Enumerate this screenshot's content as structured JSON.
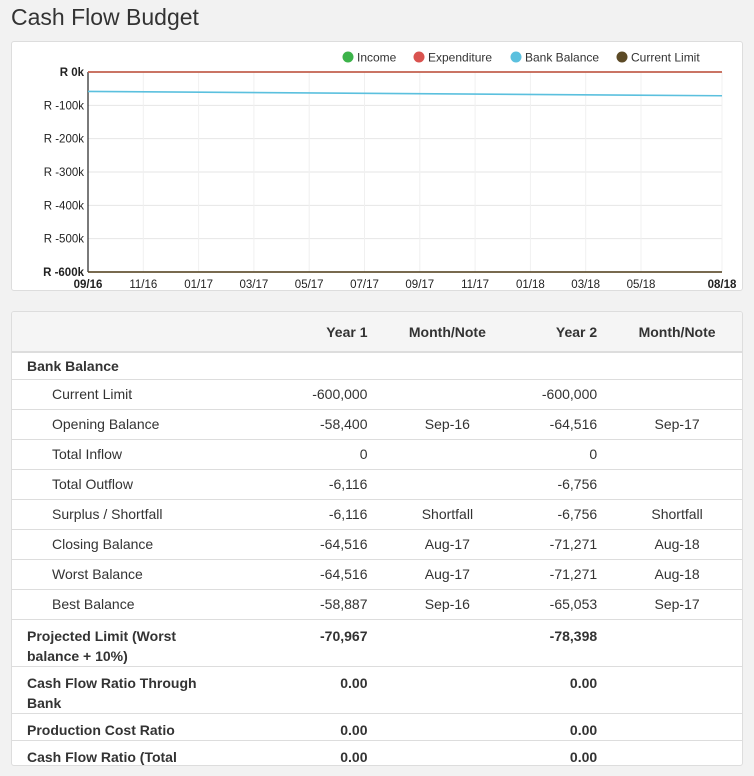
{
  "page": {
    "title": "Cash Flow Budget"
  },
  "chart_data": {
    "type": "line",
    "legend": [
      {
        "name": "Income",
        "color": "#3cb34a"
      },
      {
        "name": "Expenditure",
        "color": "#d9534f"
      },
      {
        "name": "Bank Balance",
        "color": "#5bc0de"
      },
      {
        "name": "Current Limit",
        "color": "#5c4a26"
      }
    ],
    "legend_position": "top-right",
    "y_ticks": [
      "R 0k",
      "R -100k",
      "R -200k",
      "R -300k",
      "R -400k",
      "R -500k",
      "R -600k"
    ],
    "y_values": [
      0,
      -100000,
      -200000,
      -300000,
      -400000,
      -500000,
      -600000
    ],
    "ylim": [
      -600000,
      0
    ],
    "x_ticks": [
      "09/16",
      "11/16",
      "01/17",
      "03/17",
      "05/17",
      "07/17",
      "09/17",
      "11/17",
      "01/18",
      "03/18",
      "05/18",
      "08/18"
    ],
    "x": [
      "09/16",
      "08/18"
    ],
    "series": [
      {
        "name": "Income",
        "color": "#3cb34a",
        "values": [
          0,
          0
        ]
      },
      {
        "name": "Expenditure",
        "color": "#d9534f",
        "values": [
          0,
          0
        ]
      },
      {
        "name": "Bank Balance",
        "color": "#5bc0de",
        "values": [
          -58400,
          -71271
        ]
      },
      {
        "name": "Current Limit",
        "color": "#5c4a26",
        "values": [
          -600000,
          -600000
        ]
      }
    ],
    "grid": true
  },
  "table": {
    "headers": [
      "",
      "Year 1",
      "Month/Note",
      "Year 2",
      "Month/Note"
    ],
    "section_label": "Bank Balance",
    "rows": [
      {
        "label": "Current Limit",
        "y1": "-600,000",
        "n1": "",
        "y2": "-600,000",
        "n2": ""
      },
      {
        "label": "Opening Balance",
        "y1": "-58,400",
        "n1": "Sep-16",
        "y2": "-64,516",
        "n2": "Sep-17"
      },
      {
        "label": "Total Inflow",
        "y1": "0",
        "n1": "",
        "y2": "0",
        "n2": ""
      },
      {
        "label": "Total Outflow",
        "y1": "-6,116",
        "n1": "",
        "y2": "-6,756",
        "n2": ""
      },
      {
        "label": "Surplus / Shortfall",
        "y1": "-6,116",
        "n1": "Shortfall",
        "y2": "-6,756",
        "n2": "Shortfall"
      },
      {
        "label": "Closing Balance",
        "y1": "-64,516",
        "n1": "Aug-17",
        "y2": "-71,271",
        "n2": "Aug-18"
      },
      {
        "label": "Worst Balance",
        "y1": "-64,516",
        "n1": "Aug-17",
        "y2": "-71,271",
        "n2": "Aug-18"
      },
      {
        "label": "Best Balance",
        "y1": "-58,887",
        "n1": "Sep-16",
        "y2": "-65,053",
        "n2": "Sep-17"
      }
    ],
    "summary": [
      {
        "label": "Projected Limit (Worst balance + 10%)",
        "y1": "-70,967",
        "y2": "-78,398"
      },
      {
        "label": "Cash Flow Ratio Through Bank",
        "y1": "0.00",
        "y2": "0.00"
      },
      {
        "label": "Production Cost Ratio",
        "y1": "0.00",
        "y2": "0.00"
      },
      {
        "label": "Cash Flow Ratio (Total Farming Concern)",
        "y1": "0.00",
        "y2": "0.00"
      }
    ]
  }
}
